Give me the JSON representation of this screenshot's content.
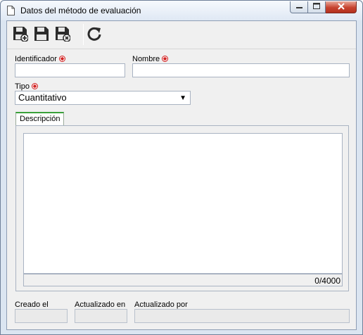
{
  "window": {
    "title": "Datos del método de evaluación",
    "icon": "document-icon",
    "controls": [
      "minimize-icon",
      "maximize-icon",
      "close-icon"
    ]
  },
  "toolbar": {
    "buttons": [
      {
        "name": "save-and-new",
        "icon": "floppy-plus-icon"
      },
      {
        "name": "save",
        "icon": "floppy-icon"
      },
      {
        "name": "save-and-close",
        "icon": "floppy-close-icon"
      },
      {
        "name": "refresh",
        "icon": "refresh-icon"
      }
    ]
  },
  "form": {
    "identificador": {
      "label": "Identificador",
      "value": ""
    },
    "nombre": {
      "label": "Nombre",
      "value": ""
    },
    "tipo": {
      "label": "Tipo",
      "value": "Cuantitativo"
    },
    "descripcion": {
      "tab_label": "Descripción",
      "value": "",
      "counter": "0/4000"
    },
    "creado_el": {
      "label": "Creado el",
      "value": ""
    },
    "actualizado_en": {
      "label": "Actualizado en",
      "value": ""
    },
    "actualizado_por": {
      "label": "Actualizado por",
      "value": ""
    }
  },
  "colors": {
    "required_marker": "#d21f1f",
    "tab_accent": "#3aa13a",
    "close_button": "#c7432f"
  }
}
